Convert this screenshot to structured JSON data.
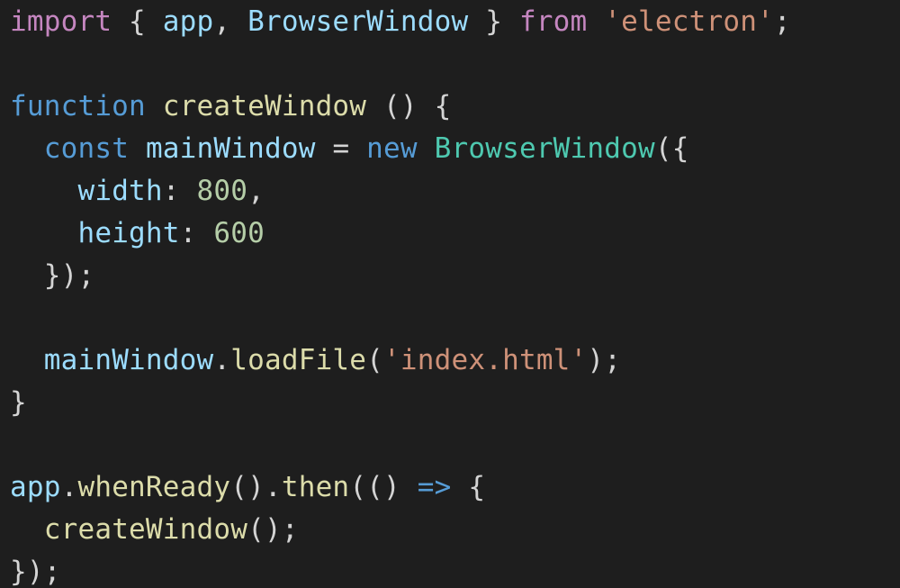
{
  "colors": {
    "background": "#1e1e1e",
    "keyword": "#c586c0",
    "string": "#ce9178",
    "function": "#dcdcaa",
    "identifier": "#9cdcfe",
    "type": "#4ec9b0",
    "number": "#b5cea8",
    "storage": "#569cd6",
    "plain": "#d4d4d4"
  },
  "code": {
    "lines": [
      {
        "tokens": [
          {
            "t": "import",
            "c": "kw"
          },
          {
            "t": " { ",
            "c": "pl"
          },
          {
            "t": "app",
            "c": "id"
          },
          {
            "t": ", ",
            "c": "pl"
          },
          {
            "t": "BrowserWindow",
            "c": "id"
          },
          {
            "t": " } ",
            "c": "pl"
          },
          {
            "t": "from",
            "c": "kw"
          },
          {
            "t": " ",
            "c": "pl"
          },
          {
            "t": "'electron'",
            "c": "st"
          },
          {
            "t": ";",
            "c": "pl"
          }
        ]
      },
      {
        "tokens": []
      },
      {
        "tokens": [
          {
            "t": "function",
            "c": "sk"
          },
          {
            "t": " ",
            "c": "pl"
          },
          {
            "t": "createWindow",
            "c": "fn"
          },
          {
            "t": " () {",
            "c": "pl"
          }
        ]
      },
      {
        "tokens": [
          {
            "t": "  ",
            "c": "pl"
          },
          {
            "t": "const",
            "c": "sk"
          },
          {
            "t": " ",
            "c": "pl"
          },
          {
            "t": "mainWindow",
            "c": "id"
          },
          {
            "t": " = ",
            "c": "pl"
          },
          {
            "t": "new",
            "c": "sk"
          },
          {
            "t": " ",
            "c": "pl"
          },
          {
            "t": "BrowserWindow",
            "c": "ty"
          },
          {
            "t": "({",
            "c": "pl"
          }
        ]
      },
      {
        "tokens": [
          {
            "t": "    ",
            "c": "pl"
          },
          {
            "t": "width",
            "c": "id"
          },
          {
            "t": ": ",
            "c": "pl"
          },
          {
            "t": "800",
            "c": "nm"
          },
          {
            "t": ",",
            "c": "pl"
          }
        ]
      },
      {
        "tokens": [
          {
            "t": "    ",
            "c": "pl"
          },
          {
            "t": "height",
            "c": "id"
          },
          {
            "t": ": ",
            "c": "pl"
          },
          {
            "t": "600",
            "c": "nm"
          }
        ]
      },
      {
        "tokens": [
          {
            "t": "  });",
            "c": "pl"
          }
        ]
      },
      {
        "tokens": []
      },
      {
        "tokens": [
          {
            "t": "  ",
            "c": "pl"
          },
          {
            "t": "mainWindow",
            "c": "id"
          },
          {
            "t": ".",
            "c": "pl"
          },
          {
            "t": "loadFile",
            "c": "fn"
          },
          {
            "t": "(",
            "c": "pl"
          },
          {
            "t": "'index.html'",
            "c": "st"
          },
          {
            "t": ");",
            "c": "pl"
          }
        ]
      },
      {
        "tokens": [
          {
            "t": "}",
            "c": "pl"
          }
        ]
      },
      {
        "tokens": []
      },
      {
        "tokens": [
          {
            "t": "app",
            "c": "id"
          },
          {
            "t": ".",
            "c": "pl"
          },
          {
            "t": "whenReady",
            "c": "fn"
          },
          {
            "t": "().",
            "c": "pl"
          },
          {
            "t": "then",
            "c": "fn"
          },
          {
            "t": "(() ",
            "c": "pl"
          },
          {
            "t": "=>",
            "c": "sk"
          },
          {
            "t": " {",
            "c": "pl"
          }
        ]
      },
      {
        "tokens": [
          {
            "t": "  ",
            "c": "pl"
          },
          {
            "t": "createWindow",
            "c": "fn"
          },
          {
            "t": "();",
            "c": "pl"
          }
        ]
      },
      {
        "tokens": [
          {
            "t": "});",
            "c": "pl"
          }
        ]
      }
    ]
  }
}
